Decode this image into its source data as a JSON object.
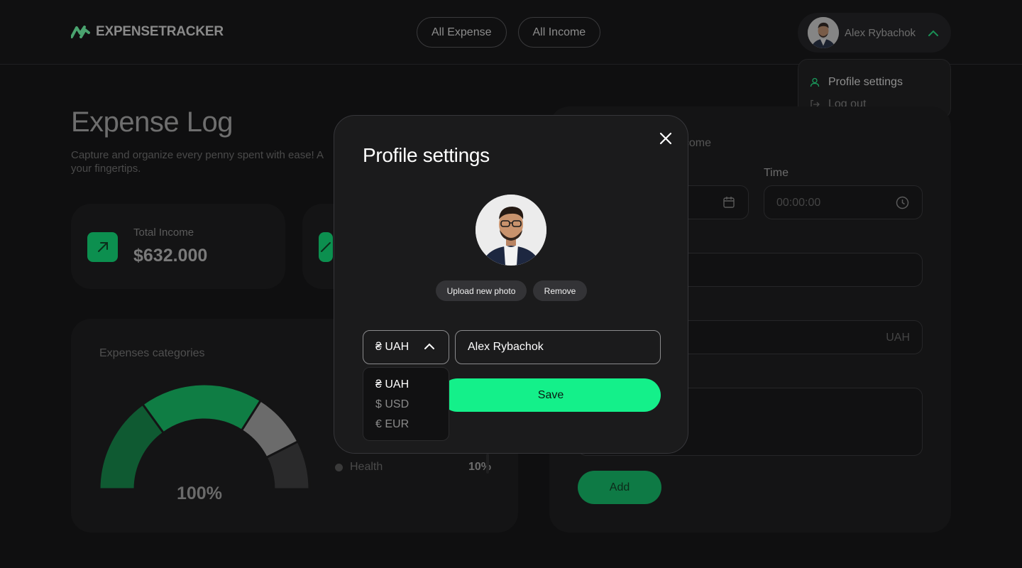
{
  "header": {
    "logo_text": "EXPENSETRACKER",
    "nav": [
      {
        "label": "All Expense"
      },
      {
        "label": "All  Income"
      }
    ],
    "user_name": "Alex Rybachok"
  },
  "user_menu": {
    "items": [
      {
        "label": "Profile settings",
        "icon": "user-icon"
      },
      {
        "label": "Log out",
        "icon": "logout-icon"
      }
    ]
  },
  "page": {
    "title": "Expense Log",
    "subtitle": "Capture and organize every penny spent with ease! A",
    "subtitle_2": "your fingertips."
  },
  "stats": [
    {
      "label": "Total Income",
      "value": "$632.000"
    }
  ],
  "categories_card": {
    "title": "Expenses categories",
    "gauge_percent": "100%",
    "legend": [
      {
        "name": "Health",
        "value": "10%"
      }
    ],
    "segments": [
      {
        "color": "#0f5a32",
        "fraction": 0.3
      },
      {
        "color": "#0f7d44",
        "fraction": 0.38
      },
      {
        "color": "#6b6b6b",
        "fraction": 0.17
      },
      {
        "color": "#2a2a2b",
        "fraction": 0.15
      }
    ]
  },
  "form_card": {
    "toggle_label": "ncome",
    "time_label": "Time",
    "time_placeholder": "00:00:00",
    "currency_suffix": "UAH",
    "add_label": "Add"
  },
  "modal": {
    "title": "Profile settings",
    "upload_label": "Upload new photo",
    "remove_label": "Remove",
    "currency_selected": "₴ UAH",
    "name_value": "Alex Rybachok",
    "save_label": "Save",
    "currency_options": [
      "₴ UAH",
      "$ USD",
      "€ EUR"
    ]
  },
  "colors": {
    "accent": "#14f08a",
    "accent_dark": "#0c8f4f",
    "modal_bg": "#1b1b1c",
    "page_bg": "#0f0f10"
  }
}
